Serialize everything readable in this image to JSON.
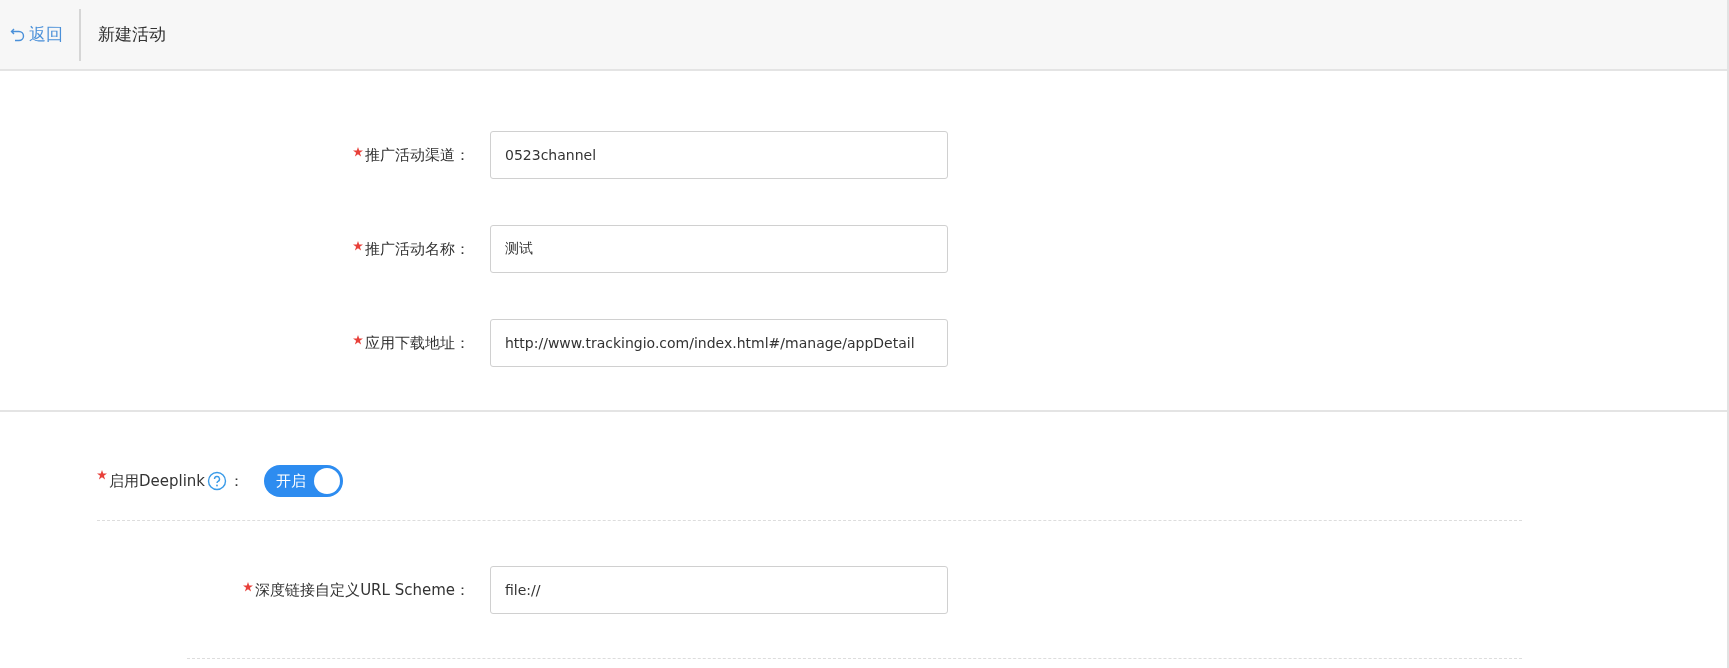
{
  "header": {
    "back_label": "返回",
    "title": "新建活动"
  },
  "fields": [
    {
      "label": "推广活动渠道：",
      "required": true,
      "value": "0523channel"
    },
    {
      "label": "推广活动名称：",
      "required": true,
      "value": "测试"
    },
    {
      "label": "应用下载地址：",
      "required": true,
      "value": "http://www.trackingio.com/index.html#/manage/appDetail"
    }
  ],
  "deeplink": {
    "label": "启用Deeplink",
    "colon": "：",
    "required": true,
    "toggle": {
      "on": true,
      "label": "开启"
    }
  },
  "deeplink_fields": [
    {
      "label": "深度链接自定义URL Scheme：",
      "required": true,
      "value": "file://"
    }
  ]
}
